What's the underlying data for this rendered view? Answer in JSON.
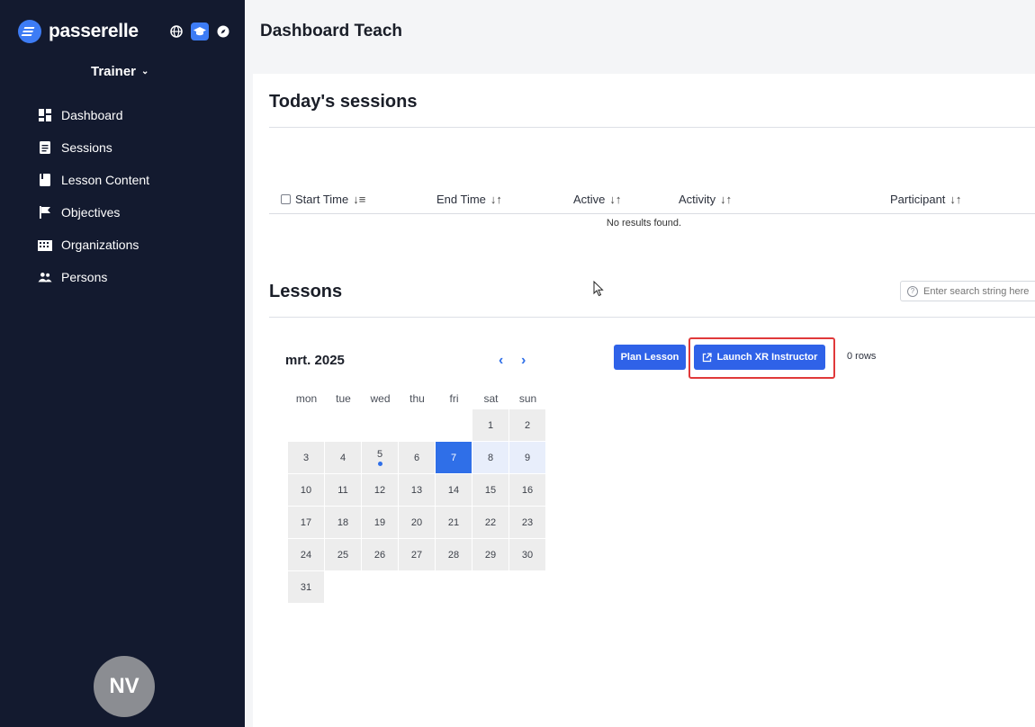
{
  "app": {
    "brand": "passerelle",
    "role": "Trainer",
    "avatar_initials": "NV",
    "accent_color": "#3d7cf5"
  },
  "sidebar": {
    "items": [
      {
        "label": "Dashboard",
        "icon": "dashboard-icon"
      },
      {
        "label": "Sessions",
        "icon": "sessions-icon"
      },
      {
        "label": "Lesson Content",
        "icon": "book-icon"
      },
      {
        "label": "Objectives",
        "icon": "flag-icon"
      },
      {
        "label": "Organizations",
        "icon": "building-icon"
      },
      {
        "label": "Persons",
        "icon": "people-icon"
      }
    ]
  },
  "header": {
    "title": "Dashboard Teach"
  },
  "sessions": {
    "title": "Today's sessions",
    "columns": [
      "Start Time",
      "End Time",
      "Active",
      "Activity",
      "Participant"
    ],
    "empty_text": "No results found."
  },
  "lessons": {
    "title": "Lessons",
    "search_placeholder": "Enter search string here",
    "plan_lesson_label": "Plan Lesson",
    "launch_label": "Launch XR Instructor",
    "rows_label": "0 rows"
  },
  "calendar": {
    "month_label": "mrt. 2025",
    "weekdays": [
      "mon",
      "tue",
      "wed",
      "thu",
      "fri",
      "sat",
      "sun"
    ],
    "leading_blanks": 5,
    "days": [
      "1",
      "2",
      "3",
      "4",
      "5",
      "6",
      "7",
      "8",
      "9",
      "10",
      "11",
      "12",
      "13",
      "14",
      "15",
      "16",
      "17",
      "18",
      "19",
      "20",
      "21",
      "22",
      "23",
      "24",
      "25",
      "26",
      "27",
      "28",
      "29",
      "30",
      "31"
    ],
    "selected_day": "7",
    "light_days": [
      "8",
      "9"
    ],
    "event_days": [
      "5"
    ]
  }
}
